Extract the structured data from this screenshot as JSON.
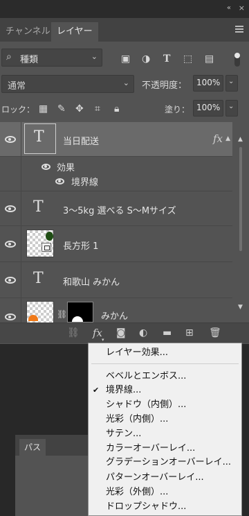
{
  "window": {
    "collapse_icon": "«",
    "close_icon": "×"
  },
  "tabs": [
    {
      "label": "チャンネル",
      "active": false
    },
    {
      "label": "レイヤー",
      "active": true
    }
  ],
  "filter": {
    "label": "種類",
    "icons": [
      "image-filter-icon",
      "adjustment-filter-icon",
      "type-filter-icon",
      "shape-filter-icon",
      "smart-object-filter-icon"
    ]
  },
  "blend": {
    "mode": "通常",
    "opacity_label": "不透明度：",
    "opacity_value": "100%"
  },
  "lock": {
    "label": "ロック：",
    "fill_label": "塗り：",
    "fill_value": "100%"
  },
  "layers": [
    {
      "name": "当日配送",
      "kind": "text",
      "selected": true,
      "fx": "fx",
      "effects_label": "効果",
      "effects": [
        "境界線"
      ]
    },
    {
      "name": "3～5kg 選べる S～Mサイズ",
      "kind": "text"
    },
    {
      "name": "長方形 1",
      "kind": "shape"
    },
    {
      "name": "和歌山 みかん",
      "kind": "text"
    },
    {
      "name": "みかん",
      "kind": "image"
    }
  ],
  "bottom_bar": {
    "fx": "fx",
    "chevron": "▾"
  },
  "context_menu": {
    "items": [
      {
        "label": "レイヤー効果...",
        "checked": false
      },
      {
        "label": "ベベルとエンボス...",
        "checked": false
      },
      {
        "label": "境界線...",
        "checked": true
      },
      {
        "label": "シャドウ（内側）...",
        "checked": false
      },
      {
        "label": "光彩（内側）...",
        "checked": false
      },
      {
        "label": "サテン...",
        "checked": false
      },
      {
        "label": "カラーオーバーレイ...",
        "checked": false
      },
      {
        "label": "グラデーションオーバーレイ...",
        "checked": false
      },
      {
        "label": "パターンオーバーレイ...",
        "checked": false
      },
      {
        "label": "光彩（外側）...",
        "checked": false
      },
      {
        "label": "ドロップシャドウ...",
        "checked": false
      }
    ]
  },
  "path_panel": {
    "tab": "パス"
  },
  "colors": {
    "panel": "#535353",
    "selected_row": "#6a6a6a",
    "menu_bg": "#f0f0f0",
    "orange": "#f07a1a",
    "green": "#1f4d14"
  }
}
